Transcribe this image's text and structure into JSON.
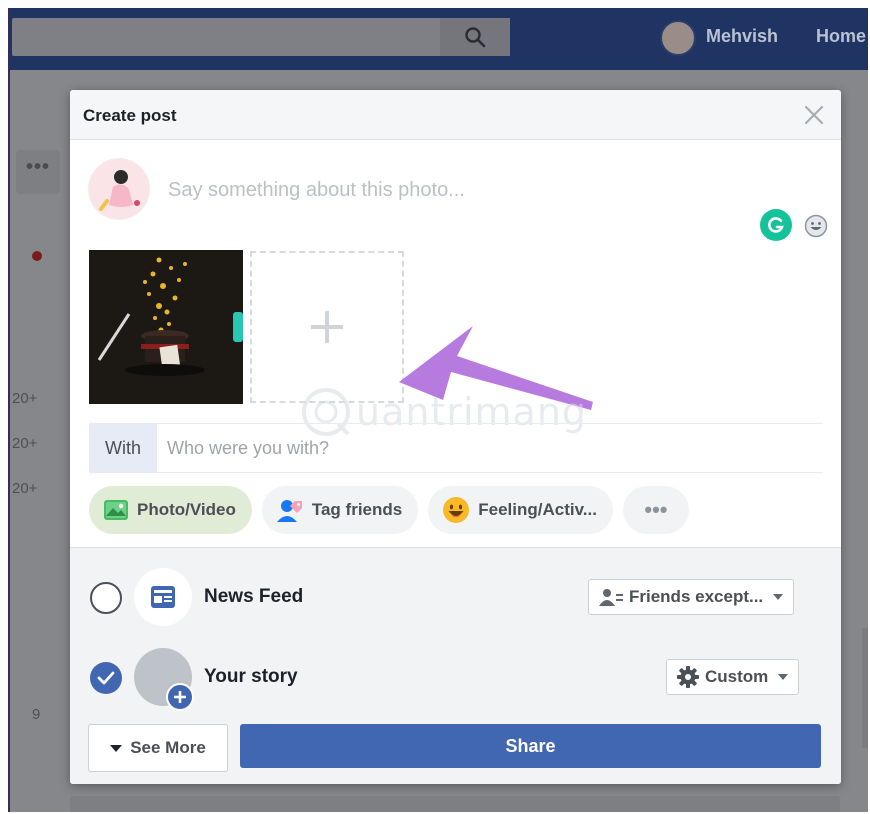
{
  "topbar": {
    "user_name": "Mehvish",
    "home_label": "Home"
  },
  "background": {
    "more_label": "•••",
    "counts": [
      "20+",
      "20+",
      "20+"
    ],
    "side_number": "9"
  },
  "dialog": {
    "title": "Create post",
    "compose_placeholder": "Say something about this photo...",
    "with_label": "With",
    "with_placeholder": "Who were you with?",
    "chips": [
      {
        "label": "Photo/Video",
        "icon": "photo-icon"
      },
      {
        "label": "Tag friends",
        "icon": "tag-friends-icon"
      },
      {
        "label": "Feeling/Activ...",
        "icon": "feeling-emoji-icon"
      },
      {
        "label": "•••",
        "icon": "more-icon"
      }
    ],
    "options": [
      {
        "label": "News Feed",
        "checked": false,
        "audience": "Friends except..."
      },
      {
        "label": "Your story",
        "checked": true,
        "audience": "Custom"
      }
    ],
    "see_more_label": "See More",
    "share_label": "Share"
  },
  "watermark": {
    "text": "uantrimang"
  },
  "colors": {
    "header_bg": "#1f3463",
    "primary": "#4267b2",
    "grammarly": "#15c39a",
    "photo_chip_bg": "#e1ecd6",
    "annotation_arrow": "#b77be0"
  }
}
